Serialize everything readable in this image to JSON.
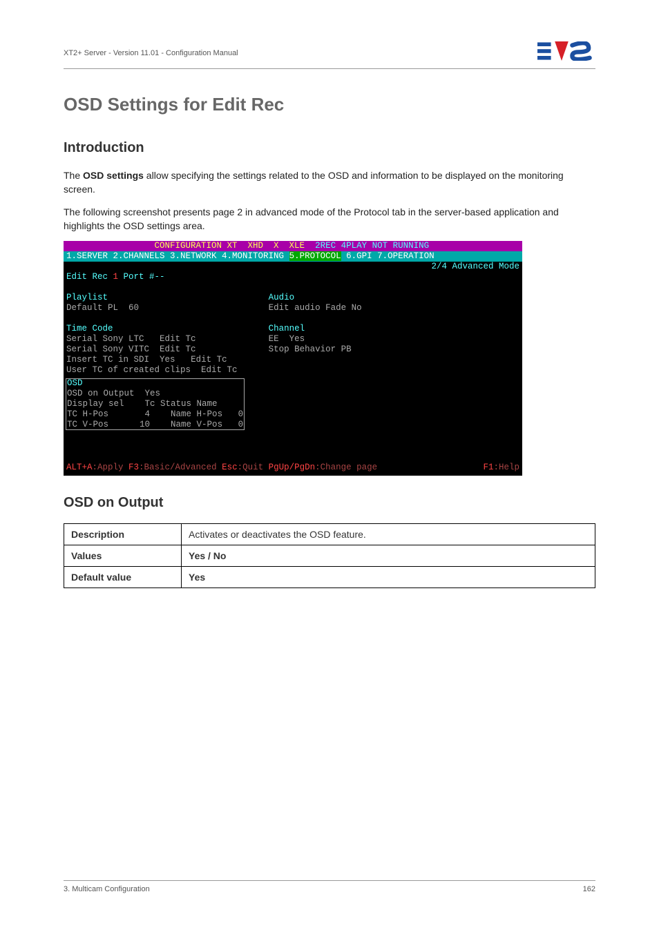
{
  "header": {
    "doc_title": "XT2+ Server - Version 11.01 - Configuration Manual"
  },
  "section": {
    "title": "OSD Settings for Edit Rec",
    "intro_head": "Introduction",
    "intro_p1_a": "The ",
    "intro_p1_b": "OSD settings",
    "intro_p1_c": " allow specifying the settings related to the OSD and information to be displayed on the monitoring screen.",
    "intro_p2": "The following screenshot presents page 2 in advanced mode of the Protocol tab in the server-based application and highlights the OSD settings area."
  },
  "terminal": {
    "top_left": "                 CONFIGURATION XT  XHD  X  XLE  ",
    "top_right": "2REC 4PLAY NOT RUNNING",
    "tabs_line_pre": "1.SERVER 2.CHANNELS 3.NETWORK 4.MONITORING ",
    "tabs_proto": "5.PROTOCOL",
    "tabs_line_post": " 6.GPI 7.OPERATION",
    "mode_line": "2/4 Advanced Mode",
    "port_seg1": "Edit Rec ",
    "port_seg2": "1",
    "port_seg3": " Port #--",
    "playlist_head": "Playlist",
    "default_pl_label": "Default PL  ",
    "default_pl_val": "60",
    "audio_head": "Audio",
    "audio_fade_label": "Edit audio Fade ",
    "audio_fade_val": "No",
    "tc_head": "Time Code",
    "tc_r1_l": "Serial Sony LTC   ",
    "tc_r1_v": "Edit Tc",
    "tc_r2_l": "Serial Sony VITC  ",
    "tc_r2_v": "Edit Tc",
    "tc_r3_l": "Insert TC in SDI  ",
    "tc_r3_v1": "Yes",
    "tc_r3_sp": "   ",
    "tc_r3_v2": "Edit Tc",
    "tc_r4_l": "User TC of created clips  ",
    "tc_r4_v": "Edit Tc",
    "chan_head": "Channel",
    "chan_r1_l": "EE  ",
    "chan_r1_v": "Yes",
    "chan_r2_l": "Stop Behavior ",
    "chan_r2_v": "PB",
    "osd_head": "OSD",
    "osd_r1_l": "OSD on Output  ",
    "osd_r1_v": "Yes",
    "osd_r2_l": "Display sel    ",
    "osd_r2_v": "Tc Status Name",
    "osd_r3_l": "TC H-Pos       ",
    "osd_r3_v1": "4",
    "osd_r3_l2": "    Name H-Pos   ",
    "osd_r3_v2": "0",
    "osd_r4_l": "TC V-Pos      ",
    "osd_r4_v1": "10",
    "osd_r4_l2": "    Name V-Pos   ",
    "osd_r4_v2": "0",
    "footer_alt": "ALT+A",
    "footer_apply": ":Apply ",
    "footer_f3": "F3",
    "footer_basic": ":Basic/Advanced ",
    "footer_esc": "Esc",
    "footer_quit": ":Quit ",
    "footer_pg": "PgUp/PgDn",
    "footer_change": ":Change page",
    "footer_f1": "F1",
    "footer_help": ":Help"
  },
  "osd_output": {
    "head": "OSD on Output",
    "rows": {
      "desc_label": "Description",
      "desc_val": "Activates or deactivates the OSD feature.",
      "values_label": "Values",
      "values_val": "Yes / No",
      "default_label": "Default value",
      "default_val": "Yes"
    }
  },
  "footer": {
    "left": "3. Multicam Configuration",
    "right": "162"
  }
}
